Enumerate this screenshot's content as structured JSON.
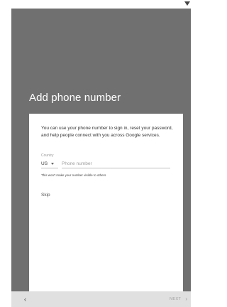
{
  "page": {
    "title": "Add phone number",
    "description": "You can use your phone number to sign in, reset your password, and help people connect with you across Google services."
  },
  "form": {
    "country_label": "Country",
    "country_value": "US",
    "phone_placeholder": "Phone number",
    "phone_value": "",
    "hint": "This won't make your number visible to others"
  },
  "actions": {
    "skip_label": "Skip",
    "next_label": "NEXT",
    "back_icon": "chevron-left-icon",
    "next_icon": "chevron-right-icon"
  },
  "colors": {
    "panel": "#707070",
    "bottom_bar": "#e0e0e0",
    "card": "#ffffff"
  }
}
